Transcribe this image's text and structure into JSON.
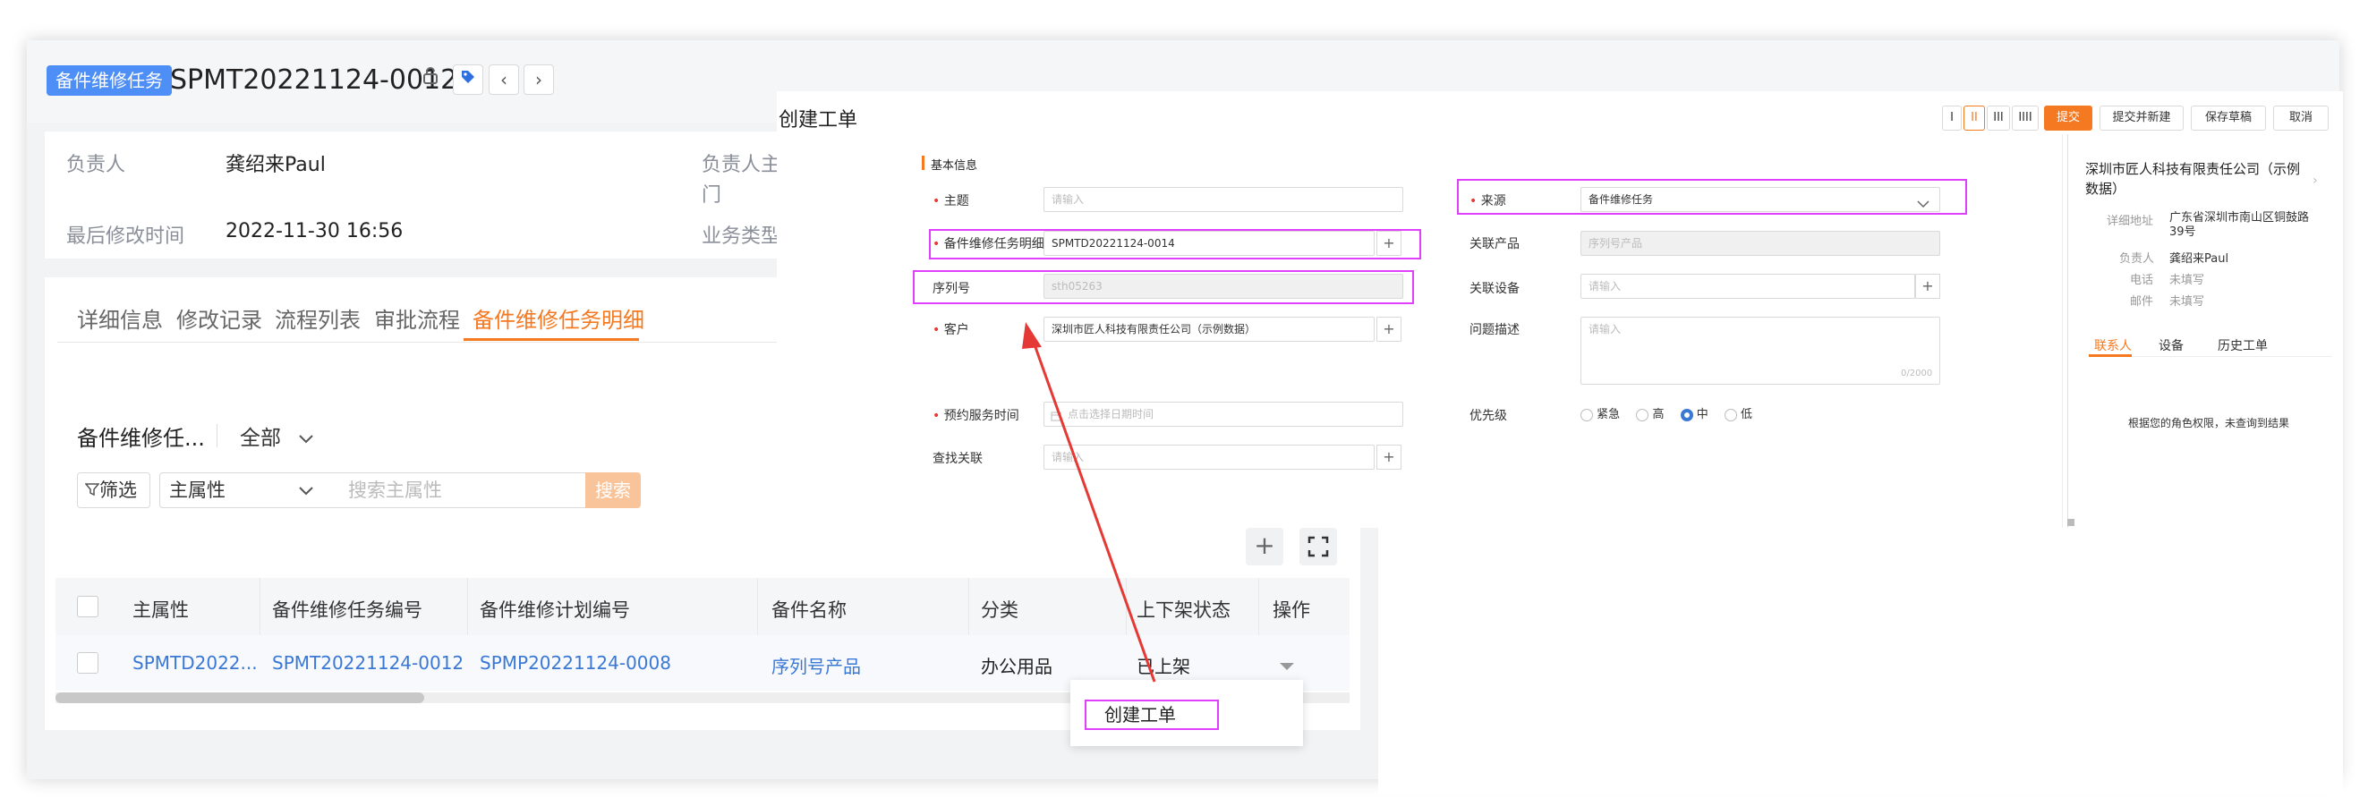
{
  "header": {
    "tag": "备件维修任务",
    "code": "SPMT20221124-0012"
  },
  "info": {
    "owner_label": "负责人",
    "owner_value": "龚绍来Paul",
    "owner_dept_label": "负责人主\n门",
    "owner_dept_label_line1": "负责人主",
    "owner_dept_label_line2": "门",
    "modified_label": "最后修改时间",
    "modified_value": "2022-11-30 16:56",
    "biz_type_label": "业务类型"
  },
  "tabs": [
    "详细信息",
    "修改记录",
    "流程列表",
    "审批流程",
    "备件维修任务明细"
  ],
  "list": {
    "title": "备件维修任...",
    "scope": "全部",
    "filter_label": "筛选",
    "field_select": "主属性",
    "search_placeholder": "搜索主属性",
    "search_button": "搜索"
  },
  "table": {
    "columns": [
      "主属性",
      "备件维修任务编号",
      "备件维修计划编号",
      "备件名称",
      "分类",
      "上下架状态",
      "操作"
    ],
    "rows": [
      [
        "SPMTD2022...",
        "SPMT20221124-0012",
        "SPMP20221124-0008",
        "序列号产品",
        "办公用品",
        "已上架",
        ""
      ]
    ]
  },
  "dropdown": {
    "create_order": "创建工单"
  },
  "modal": {
    "title": "创建工单",
    "view_modes": [
      "I",
      "II",
      "III",
      "IIII"
    ],
    "buttons": {
      "submit": "提交",
      "submit_new": "提交并新建",
      "save_draft": "保存草稿",
      "cancel": "取消"
    },
    "section": "基本信息",
    "fields": {
      "subject_label": "主题",
      "subject_placeholder": "请输入",
      "detail_label": "备件维修任务明细",
      "detail_value": "SPMTD20221124-0014",
      "serial_label": "序列号",
      "serial_value": "sth05263",
      "customer_label": "客户",
      "customer_value": "深圳市匠人科技有限责任公司（示例数据）",
      "appointment_label": "预约服务时间",
      "appointment_placeholder": "点击选择日期时间",
      "related_label": "查找关联",
      "related_placeholder": "请输入",
      "source_label": "来源",
      "source_value": "备件维修任务",
      "product_label": "关联产品",
      "product_placeholder": "序列号产品",
      "device_label": "关联设备",
      "device_placeholder": "请输入",
      "problem_label": "问题描述",
      "problem_placeholder": "请输入",
      "problem_count": "0/2000",
      "priority_label": "优先级",
      "priority_options": [
        "紧急",
        "高",
        "中",
        "低"
      ],
      "priority_selected": "中"
    },
    "side": {
      "company": "深圳市匠人科技有限责任公司（示例数据）",
      "address_label": "详细地址",
      "address_value": "广东省深圳市南山区铜鼓路39号",
      "owner_label": "负责人",
      "owner_value": "龚绍来Paul",
      "phone_label": "电话",
      "phone_value": "未填写",
      "email_label": "邮件",
      "email_value": "未填写",
      "tabs": [
        "联系人",
        "设备",
        "历史工单"
      ],
      "empty_text": "根据您的角色权限，未查询到结果"
    }
  },
  "colors": {
    "accent": "#f47920",
    "link": "#3a78d6",
    "highlight": "#e040fb",
    "arrow": "#e53935",
    "tag_bg": "#4e8ef7"
  }
}
